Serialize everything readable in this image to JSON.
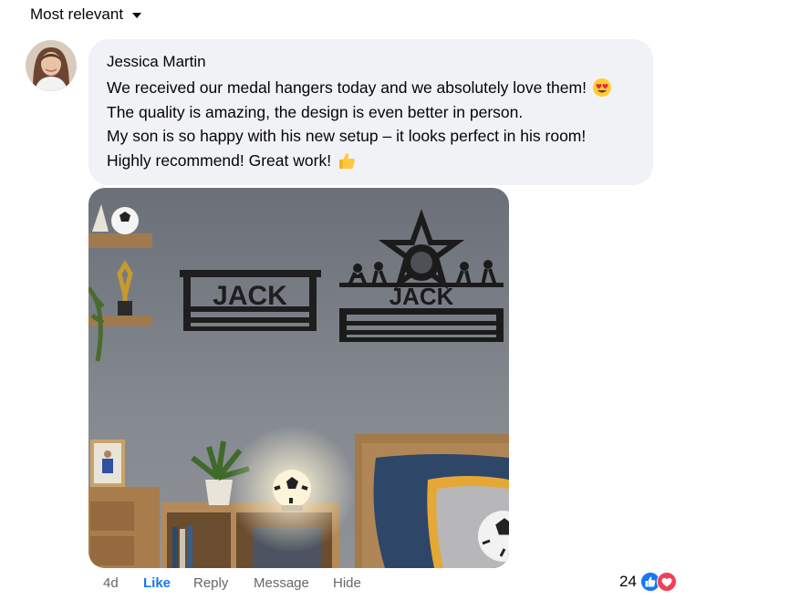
{
  "sort": {
    "label": "Most relevant"
  },
  "comment": {
    "author": "Jessica Martin",
    "lines": [
      "We received our medal hangers today and we absolutely love them!",
      "The quality is amazing, the design is even better in person.",
      "My son is so happy with his new setup – it looks perfect in his room!",
      "Highly recommend! Great work!"
    ],
    "emojis": [
      "heart-eyes-emoji",
      "thumbs-up-emoji"
    ],
    "photo": {
      "sign_left": "JACK",
      "sign_right": "JACK"
    }
  },
  "actions": {
    "time": "4d",
    "like": "Like",
    "reply": "Reply",
    "message": "Message",
    "hide": "Hide"
  },
  "reactions": {
    "count": "24",
    "icons": [
      "like-reaction-icon",
      "love-reaction-icon"
    ],
    "colors": {
      "like": "#1877f2",
      "love": "#f33e58"
    }
  },
  "colors": {
    "bubble": "#f0f2f5",
    "link": "#1877f2",
    "muted": "#65676b"
  }
}
